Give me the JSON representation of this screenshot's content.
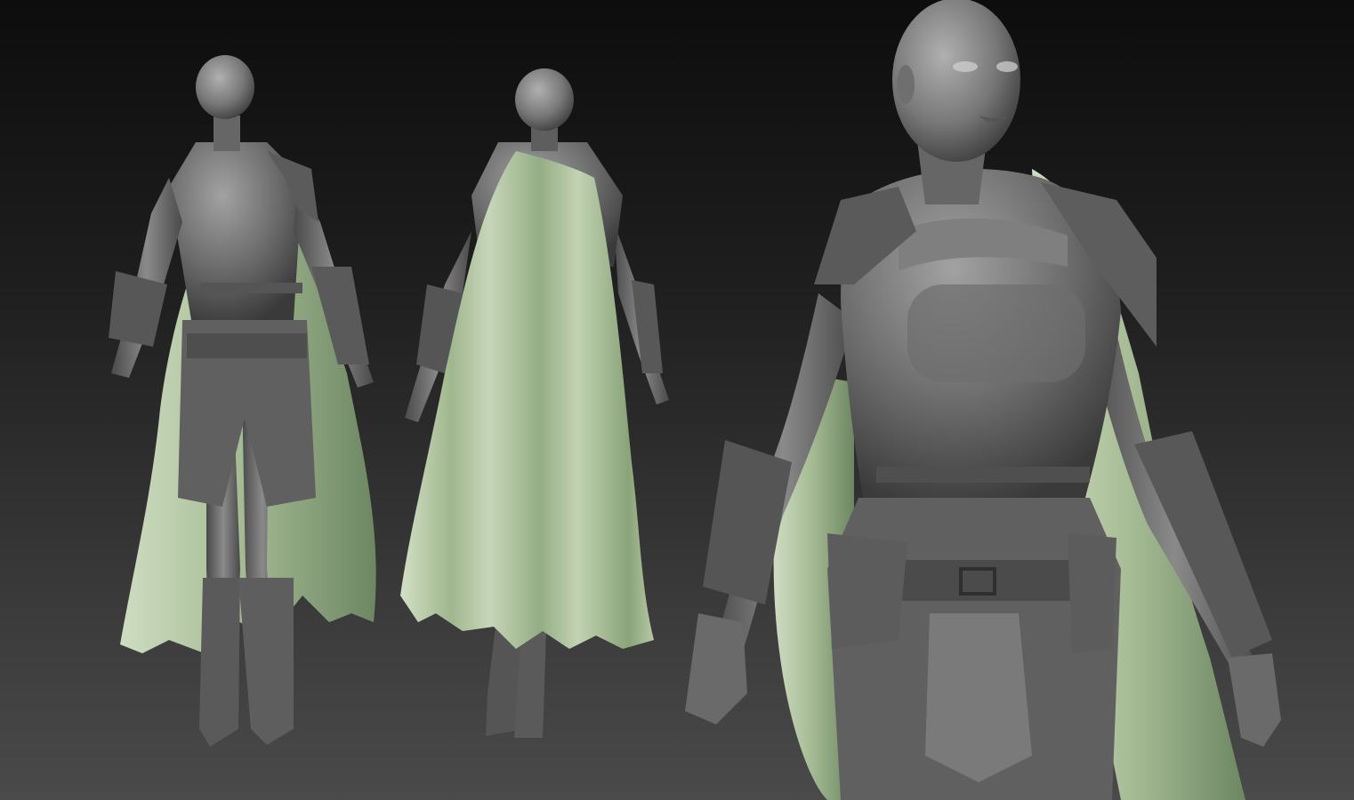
{
  "scene": {
    "description_visible_text": "",
    "colors": {
      "background_top": "#0d0d0d",
      "background_bottom": "#4a4a4a",
      "clay": "#6f6f6f",
      "clay_dark": "#3f3f3f",
      "clay_light": "#9a9a9a",
      "cape": "#a9bf98",
      "cape_dark": "#6f8a64",
      "cape_light": "#cfdcc2"
    },
    "views": [
      {
        "id": "front"
      },
      {
        "id": "back"
      },
      {
        "id": "closeup"
      }
    ]
  }
}
